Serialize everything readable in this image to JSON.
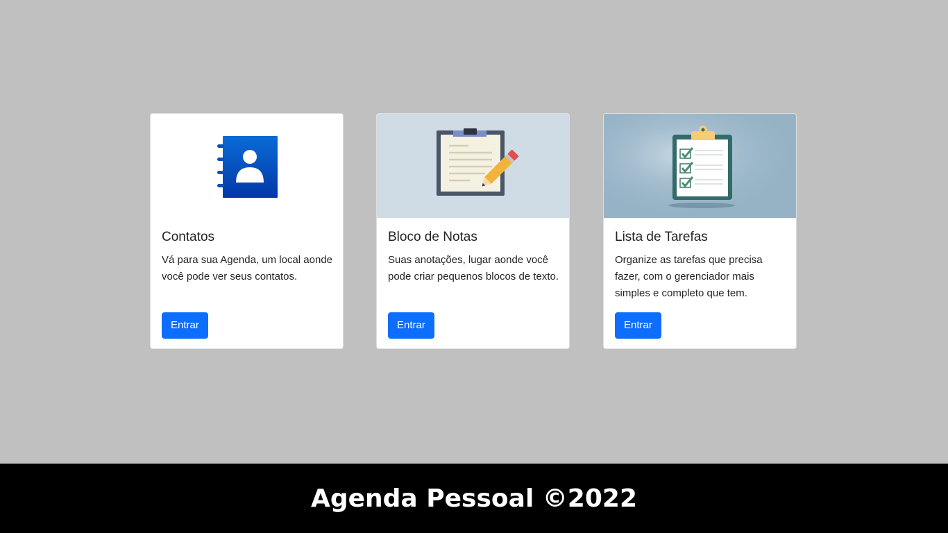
{
  "cards": [
    {
      "title": "Contatos",
      "text": "Vá para sua Agenda, um local aonde você pode ver seus contatos.",
      "button_label": "Entrar",
      "image_icon": "contacts-book-icon",
      "image_bg": "#ffffff"
    },
    {
      "title": "Bloco de Notas",
      "text": "Suas anotações, lugar aonde você pode criar pequenos blocos de texto.",
      "button_label": "Entrar",
      "image_icon": "notepad-pencil-icon",
      "image_bg": "#cfdbe5"
    },
    {
      "title": "Lista de Tarefas",
      "text": "Organize as tarefas que precisa fazer, com o gerenciador mais simples e completo que tem.",
      "button_label": "Entrar",
      "image_icon": "checklist-clipboard-icon",
      "image_bg": "#96b3c6"
    }
  ],
  "footer": {
    "text": "Agenda Pessoal ©2022"
  },
  "colors": {
    "page_bg": "#c0c0c0",
    "footer_bg": "#000000",
    "button_bg": "#0d6efd"
  }
}
